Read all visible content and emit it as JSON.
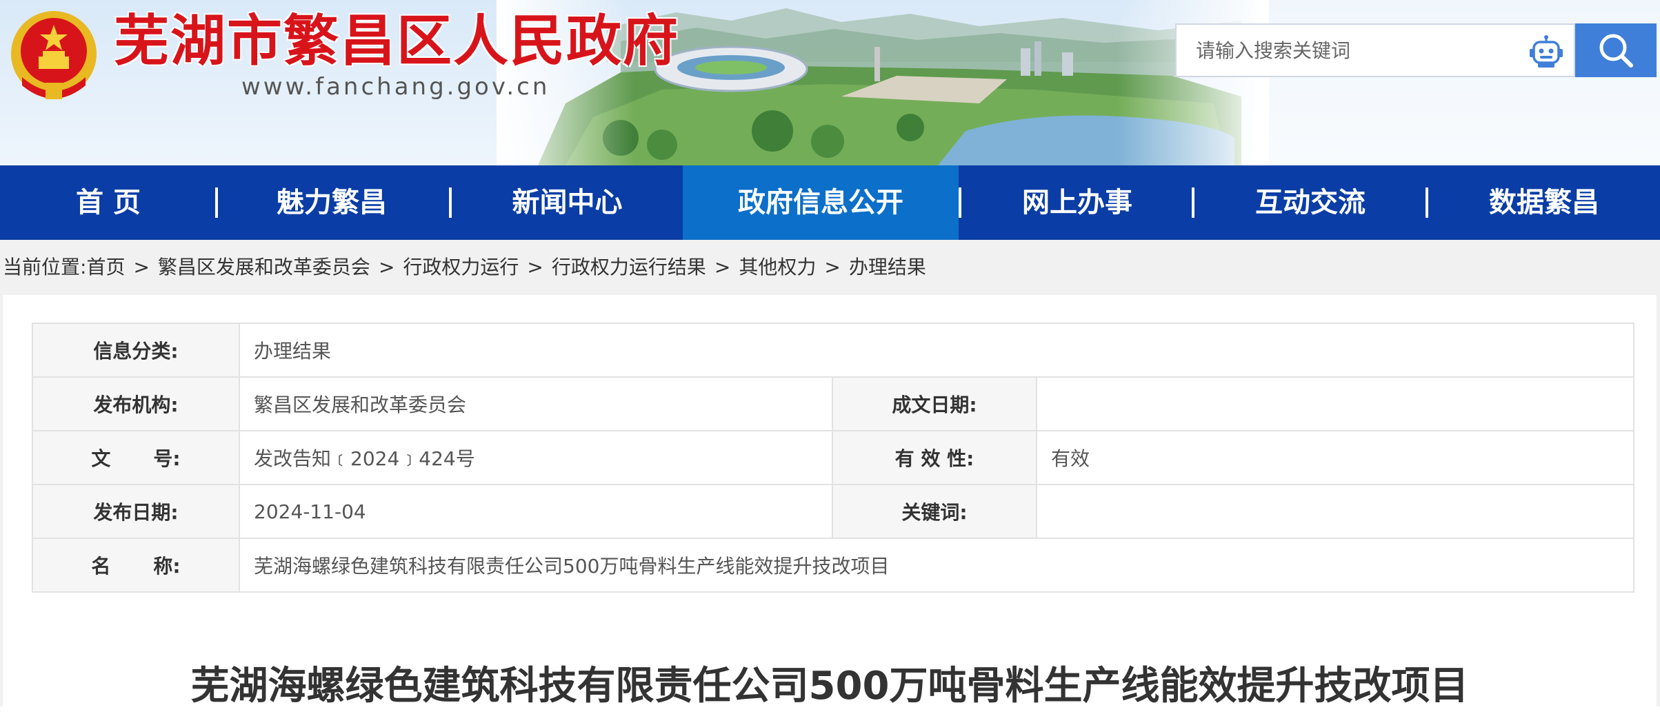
{
  "header": {
    "site_title": "芜湖市繁昌区人民政府",
    "site_url": "www.fanchang.gov.cn",
    "emblem_icon": "national-emblem-icon",
    "search": {
      "placeholder": "请输入搜索关键词",
      "value": "",
      "assistant_icon": "robot-icon",
      "button_icon": "search-icon"
    }
  },
  "nav": {
    "items": [
      {
        "label": "首 页",
        "active": false
      },
      {
        "label": "魅力繁昌",
        "active": false
      },
      {
        "label": "新闻中心",
        "active": false
      },
      {
        "label": "政府信息公开",
        "active": true
      },
      {
        "label": "网上办事",
        "active": false
      },
      {
        "label": "互动交流",
        "active": false
      },
      {
        "label": "数据繁昌",
        "active": false
      }
    ]
  },
  "breadcrumb": {
    "prefix": "当前位置:",
    "separator": ">",
    "items": [
      "首页",
      "繁昌区发展和改革委员会",
      "行政权力运行",
      "行政权力运行结果",
      "其他权力",
      "办理结果"
    ]
  },
  "info": {
    "category_label": "信息分类:",
    "category_value": "办理结果",
    "publisher_label": "发布机构:",
    "publisher_value": "繁昌区发展和改革委员会",
    "created_label": "成文日期:",
    "created_value": "",
    "doc_no_label_a": "文",
    "doc_no_label_b": "号:",
    "doc_no_value": "发改告知﹝2024﹞424号",
    "validity_label": "有 效 性:",
    "validity_value": "有效",
    "pub_date_label": "发布日期:",
    "pub_date_value": "2024-11-04",
    "keywords_label": "关键词:",
    "keywords_value": "",
    "name_label_a": "名",
    "name_label_b": "称:",
    "name_value": "芜湖海螺绿色建筑科技有限责任公司500万吨骨料生产线能效提升技改项目"
  },
  "article": {
    "title": "芜湖海螺绿色建筑科技有限责任公司500万吨骨料生产线能效提升技改项目"
  },
  "colors": {
    "title_red": "#d8141b",
    "nav_blue": "#0a3da5",
    "nav_active": "#0c6fc9",
    "search_button": "#3f7fd9"
  }
}
